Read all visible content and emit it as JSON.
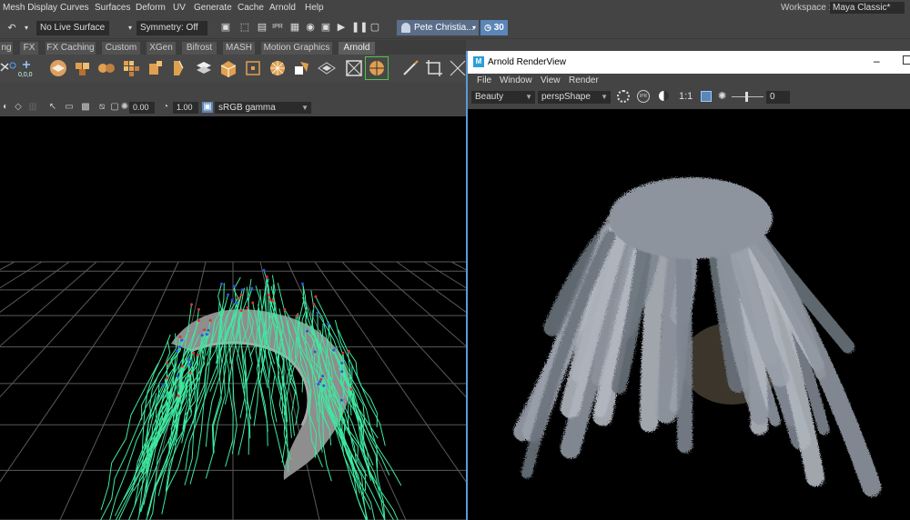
{
  "menubar": {
    "items": [
      "Mesh Display",
      "Curves",
      "Surfaces",
      "Deform",
      "UV",
      "Generate",
      "Cache",
      "Arnold",
      "Help"
    ],
    "workspace_label": "Workspace :",
    "workspace_value": "Maya Classic*"
  },
  "statusline": {
    "live_surface": "No Live Surface",
    "symmetry": "Symmetry: Off",
    "user": "Pete Christia...",
    "count": "30"
  },
  "shelf_tabs": [
    "ng",
    "FX",
    "FX Caching",
    "Custom",
    "XGen",
    "Bifrost",
    "MASH",
    "Motion Graphics",
    "Arnold"
  ],
  "viewport_toolbar": {
    "exposure": "0.00",
    "gamma": "1.00",
    "colorspace": "sRGB gamma"
  },
  "arnold": {
    "title": "Arnold RenderView",
    "menu": [
      "File",
      "Window",
      "View",
      "Render"
    ],
    "aov": "Beauty",
    "camera": "perspShape",
    "ratio": "1:1",
    "slider_value": "0",
    "accent": "#5a9ad8"
  },
  "colors": {
    "curves": "#3fe8a0",
    "mesh": "#8c8c8c",
    "grid": "#5a5a5a"
  }
}
